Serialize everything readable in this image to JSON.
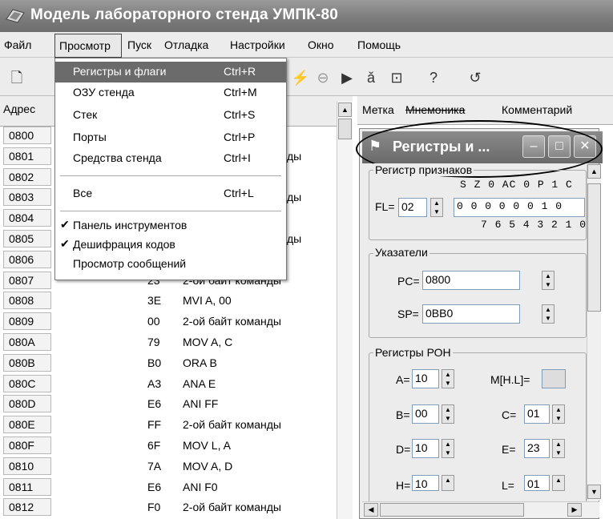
{
  "window": {
    "title": "Модель лабораторного стенда УМПК-80"
  },
  "menubar": {
    "items": [
      "Файл",
      "Просмотр",
      "Пуск",
      "Отладка",
      "Настройки",
      "Окно",
      "Помощь"
    ]
  },
  "dropdown": {
    "items": [
      {
        "label": "Регистры и флаги",
        "shortcut": "Ctrl+R"
      },
      {
        "label": "ОЗУ стенда",
        "shortcut": "Ctrl+M"
      },
      {
        "label": "Стек",
        "shortcut": "Ctrl+S"
      },
      {
        "label": "Порты",
        "shortcut": "Ctrl+P"
      },
      {
        "label": "Средства стенда",
        "shortcut": "Ctrl+I"
      },
      {
        "label": "Все",
        "shortcut": "Ctrl+L"
      },
      {
        "label": "Панель инструментов",
        "checked": true
      },
      {
        "label": "Дешифрация кодов",
        "checked": true
      },
      {
        "label": "Просмотр сообщений",
        "checked": false
      }
    ]
  },
  "list": {
    "header_addr": "Адрес",
    "rows": [
      {
        "addr": "0800",
        "code": "",
        "mnem": ""
      },
      {
        "addr": "0801",
        "code": "",
        "mnem": "ды"
      },
      {
        "addr": "0802",
        "code": "",
        "mnem": ""
      },
      {
        "addr": "0803",
        "code": "",
        "mnem": "ды"
      },
      {
        "addr": "0804",
        "code": "",
        "mnem": ""
      },
      {
        "addr": "0805",
        "code": "",
        "mnem": "ды"
      },
      {
        "addr": "0806",
        "code": "",
        "mnem": ""
      },
      {
        "addr": "0807",
        "code": "23",
        "mnem": "2-ой байт команды"
      },
      {
        "addr": "0808",
        "code": "3E",
        "mnem": "MVI A, 00"
      },
      {
        "addr": "0809",
        "code": "00",
        "mnem": "2-ой байт команды"
      },
      {
        "addr": "080A",
        "code": "79",
        "mnem": "MOV A, C"
      },
      {
        "addr": "080B",
        "code": "B0",
        "mnem": "ORA B"
      },
      {
        "addr": "080C",
        "code": "A3",
        "mnem": "ANA E"
      },
      {
        "addr": "080D",
        "code": "E6",
        "mnem": "ANI FF"
      },
      {
        "addr": "080E",
        "code": "FF",
        "mnem": "2-ой байт команды"
      },
      {
        "addr": "080F",
        "code": "6F",
        "mnem": "MOV L, A"
      },
      {
        "addr": "0810",
        "code": "7A",
        "mnem": "MOV A, D"
      },
      {
        "addr": "0811",
        "code": "E6",
        "mnem": "ANI F0"
      },
      {
        "addr": "0812",
        "code": "F0",
        "mnem": "2-ой байт команды"
      }
    ]
  },
  "right_header": {
    "col1": "Метка",
    "col2": "Мнемоника",
    "col3": "Комментарий"
  },
  "regwin": {
    "title": "Регистры и ...",
    "flags_group": "Регистр признаков",
    "flag_names": "S Z 0 AC 0 P 1 C",
    "fl_label": "FL=",
    "fl_value": "02",
    "flag_bits": "0 0 0 0 0 0 1 0",
    "bit_numbers": "7 6 5 4 3 2 1 0",
    "pointers_group": "Указатели",
    "pc_label": "PC=",
    "pc_value": "0800",
    "sp_label": "SP=",
    "sp_value": "0BB0",
    "ron_group": "Регистры РОН",
    "a_label": "A=",
    "a_value": "10",
    "mhl_label": "M[H.L]=",
    "mhl_value": "",
    "b_label": "B=",
    "b_value": "00",
    "c_label": "C=",
    "c_value": "01",
    "d_label": "D=",
    "d_value": "10",
    "e_label": "E=",
    "e_value": "23",
    "h_label": "H=",
    "h_value": "10",
    "l_label": "L=",
    "l_value": "01"
  },
  "colors": {
    "selected": "#6b6b6b",
    "titlebar": "#7a7a7a"
  }
}
